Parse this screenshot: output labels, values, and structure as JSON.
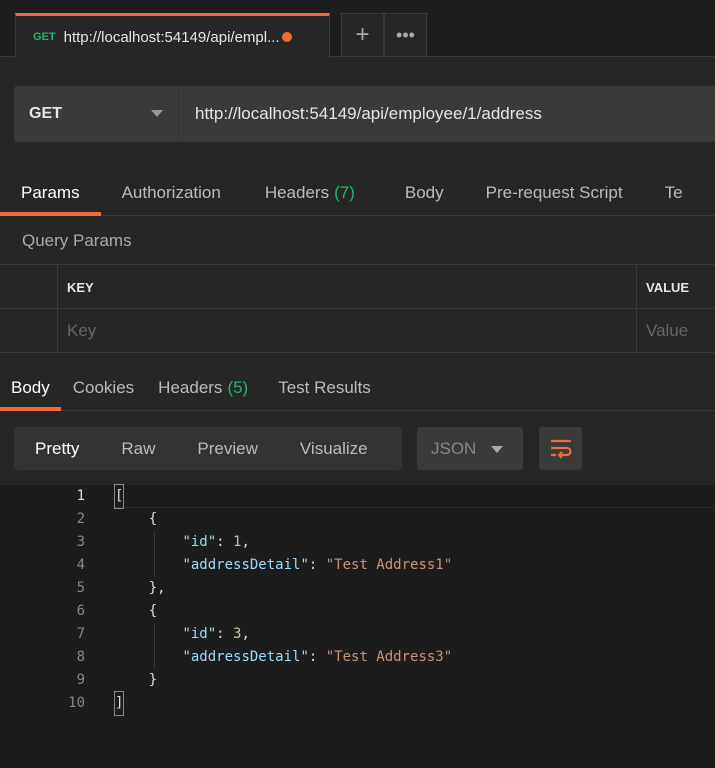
{
  "tab": {
    "method": "GET",
    "title": "http://localhost:54149/api/empl..."
  },
  "request": {
    "method": "GET",
    "url": "http://localhost:54149/api/employee/1/address"
  },
  "request_tabs": [
    {
      "label": "Params"
    },
    {
      "label": "Authorization"
    },
    {
      "label": "Headers",
      "count": "(7)"
    },
    {
      "label": "Body"
    },
    {
      "label": "Pre-request Script"
    },
    {
      "label": "Te"
    }
  ],
  "query_params": {
    "title": "Query Params",
    "key_header": "KEY",
    "value_header": "VALUE",
    "key_placeholder": "Key",
    "value_placeholder": "Value"
  },
  "response_tabs": [
    {
      "label": "Body"
    },
    {
      "label": "Cookies"
    },
    {
      "label": "Headers",
      "count": "(5)"
    },
    {
      "label": "Test Results"
    }
  ],
  "view_modes": [
    "Pretty",
    "Raw",
    "Preview",
    "Visualize"
  ],
  "format": "JSON",
  "code_lines": [
    "1",
    "2",
    "3",
    "4",
    "5",
    "6",
    "7",
    "8",
    "9",
    "10"
  ],
  "json": {
    "k_id": "\"id\"",
    "k_addr": "\"addressDetail\"",
    "id1": "1",
    "addr1": "\"Test Address1\"",
    "id2": "3",
    "addr2": "\"Test Address3\""
  },
  "colors": {
    "accent": "#f26b3a",
    "method_green": "#26b36a"
  }
}
